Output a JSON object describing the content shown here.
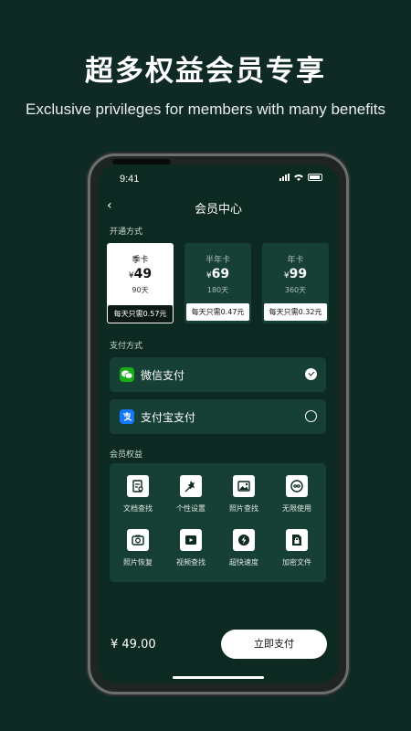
{
  "promo": {
    "title": "超多权益会员专享",
    "subtitle": "Exclusive privileges for members with many benefits"
  },
  "status": {
    "time": "9:41"
  },
  "nav": {
    "back": "‹",
    "title": "会员中心"
  },
  "sections": {
    "plans_label": "开通方式",
    "pay_label": "支付方式",
    "benefits_label": "会员权益"
  },
  "plans": [
    {
      "name": "季卡",
      "currency": "¥",
      "price": "49",
      "days": "90天",
      "daily": "每天只需0.57元",
      "selected": true
    },
    {
      "name": "半年卡",
      "currency": "¥",
      "price": "69",
      "days": "180天",
      "daily": "每天只需0.47元",
      "selected": false
    },
    {
      "name": "年卡",
      "currency": "¥",
      "price": "99",
      "days": "360天",
      "daily": "每天只需0.32元",
      "selected": false
    }
  ],
  "payments": [
    {
      "label": "微信支付",
      "icon": "wechat-icon",
      "color": "#1aad19",
      "selected": true
    },
    {
      "label": "支付宝支付",
      "icon": "alipay-icon",
      "color": "#1677ff",
      "selected": false
    }
  ],
  "benefits": [
    {
      "label": "文档查找",
      "icon": "document-search-icon"
    },
    {
      "label": "个性设置",
      "icon": "personalize-icon"
    },
    {
      "label": "照片查找",
      "icon": "photo-search-icon"
    },
    {
      "label": "无限使用",
      "icon": "unlimited-icon"
    },
    {
      "label": "照片恢复",
      "icon": "camera-restore-icon"
    },
    {
      "label": "视频查找",
      "icon": "video-search-icon"
    },
    {
      "label": "超快速度",
      "icon": "lightning-icon"
    },
    {
      "label": "加密文件",
      "icon": "lock-file-icon"
    }
  ],
  "footer": {
    "price": "¥ 49.00",
    "buy_label": "立即支付"
  },
  "colors": {
    "background": "#0f2a24",
    "screen": "#0c2a22",
    "card": "#163f35",
    "accent": "#ffffff"
  }
}
